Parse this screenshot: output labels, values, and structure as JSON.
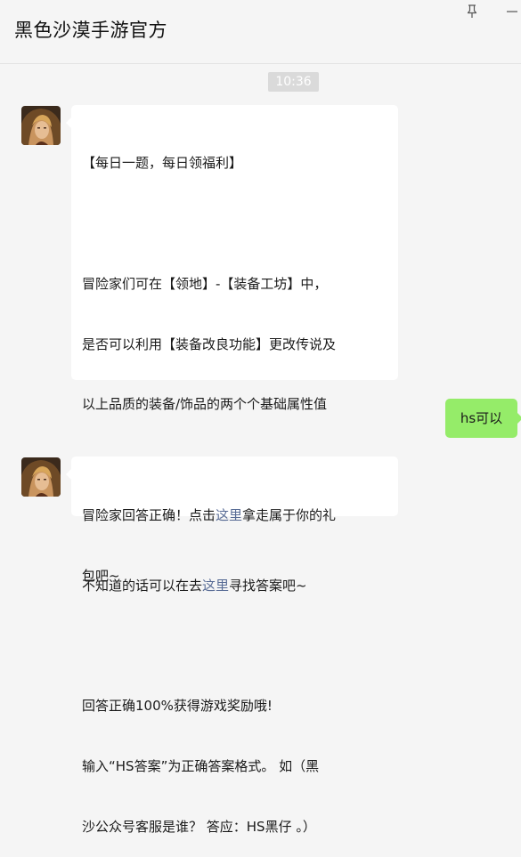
{
  "window": {
    "title": "黑色沙漠手游官方"
  },
  "chat": {
    "timestamp": "10:36",
    "messages": [
      {
        "sender": "official",
        "lines": {
          "l1": "【每日一题，每日领福利】",
          "l2": "",
          "l3": "冒险家们可在【领地】-【装备工坊】中，",
          "l4": "是否可以利用【装备改良功能】更改传说及",
          "l5": "以上品质的装备/饰品的两个个基础属性值",
          "l6": "？",
          "l7": "",
          "l8_pre": "不知道的话可以在去",
          "l8_link": "这里",
          "l8_post": "寻找答案吧~",
          "l9": "",
          "l10": "回答正确100%获得游戏奖励哦!",
          "l11": "输入“HS答案”为正确答案格式。 如（黑",
          "l12": "沙公众号客服是谁？ 答应：HS黑仔 。）"
        }
      },
      {
        "sender": "me",
        "text": "hs可以"
      },
      {
        "sender": "official",
        "lines": {
          "l1_pre": "冒险家回答正确！点击",
          "l1_link": "这里",
          "l1_post": "拿走属于你的礼",
          "l2": "包吧~"
        }
      }
    ]
  },
  "icons": {
    "pin": "pin-icon",
    "minimize": "minimize-icon",
    "avatar": "official-account-avatar"
  },
  "colors": {
    "background": "#f5f5f5",
    "incoming_bubble": "#ffffff",
    "outgoing_bubble": "#95ec69",
    "link": "#576b95",
    "timestamp_bg": "#dadada"
  }
}
